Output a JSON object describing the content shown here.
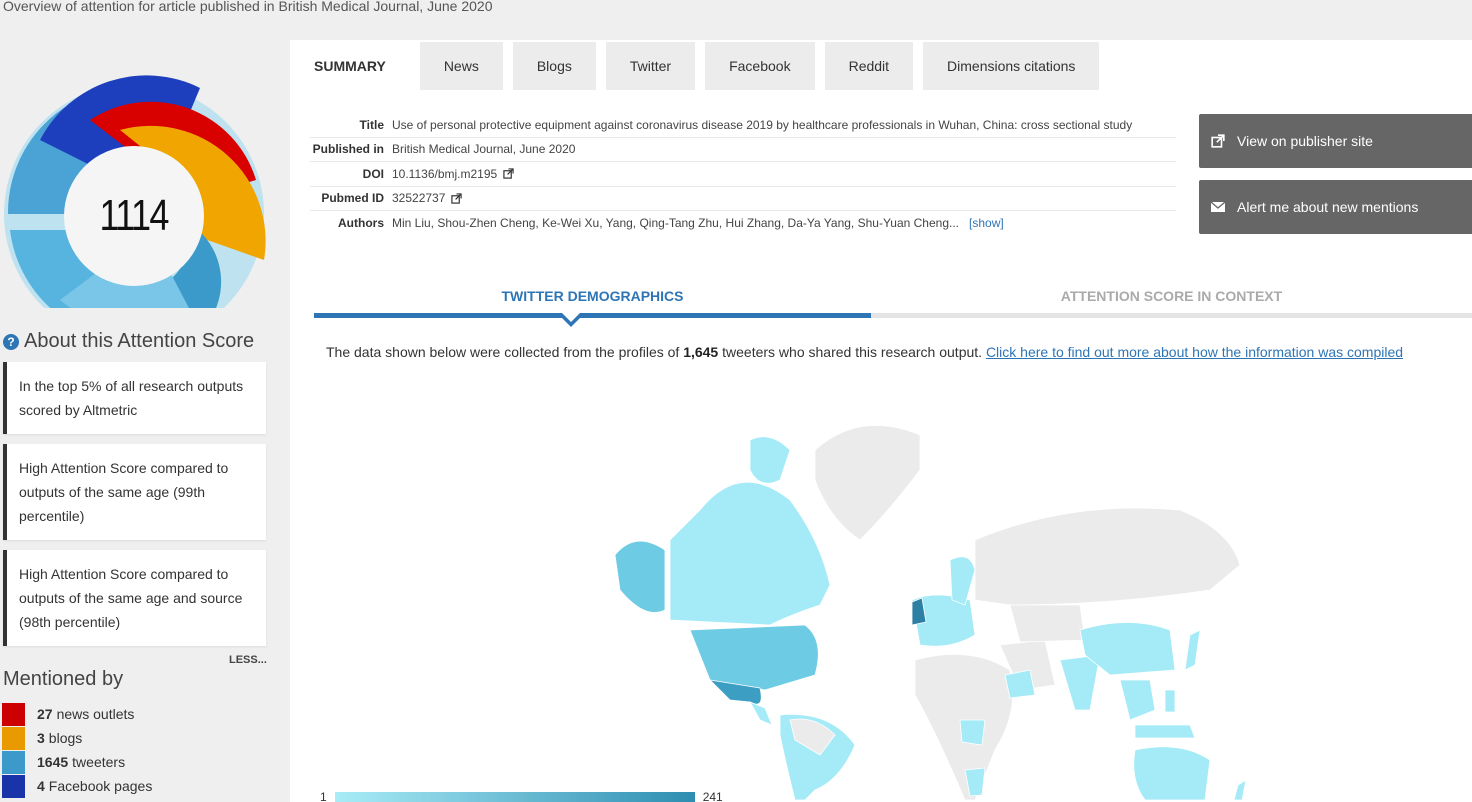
{
  "page": {
    "heading": "Overview of attention for article published in British Medical Journal, June 2020"
  },
  "score": {
    "value": "1114",
    "donut_colors": {
      "news": "#d90000",
      "blogs": "#f0a500",
      "twitter": "#4aa3d4",
      "facebook": "#1e3fbd",
      "light": "#bfe2f0"
    }
  },
  "about": {
    "title": "About this Attention Score",
    "icon": "question-icon",
    "cards": [
      "In the top 5% of all research outputs scored by Altmetric",
      "High Attention Score compared to outputs of the same age (99th percentile)",
      "High Attention Score compared to outputs of the same age and source (98th percentile)"
    ],
    "less_label": "LESS..."
  },
  "mentioned": {
    "title": "Mentioned by",
    "items": [
      {
        "count": "27",
        "label": "news outlets",
        "color": "#cc0000"
      },
      {
        "count": "3",
        "label": "blogs",
        "color": "#e89a00"
      },
      {
        "count": "1645",
        "label": "tweeters",
        "color": "#3b9ac9"
      },
      {
        "count": "4",
        "label": "Facebook pages",
        "color": "#1834a8"
      }
    ]
  },
  "tabs": [
    {
      "label": "SUMMARY",
      "active": true
    },
    {
      "label": "News"
    },
    {
      "label": "Blogs"
    },
    {
      "label": "Twitter"
    },
    {
      "label": "Facebook"
    },
    {
      "label": "Reddit"
    },
    {
      "label": "Dimensions citations"
    }
  ],
  "meta": {
    "title_label": "Title",
    "title_value": "Use of personal protective equipment against coronavirus disease 2019 by healthcare professionals in Wuhan, China: cross sectional study",
    "published_label": "Published in",
    "published_value": "British Medical Journal, June 2020",
    "doi_label": "DOI",
    "doi_value": "10.1136/bmj.m2195",
    "pubmed_label": "Pubmed ID",
    "pubmed_value": "32522737",
    "authors_label": "Authors",
    "authors_value": "Min Liu, Shou-Zhen Cheng, Ke-Wei Xu, Yang, Qing-Tang Zhu, Hui Zhang, Da-Ya Yang, Shu-Yuan Cheng...",
    "show_label": "[show]"
  },
  "actions": {
    "publisher": "View on publisher site",
    "alert": "Alert me about new mentions"
  },
  "subtabs": {
    "demographics": "TWITTER DEMOGRAPHICS",
    "context": "ATTENTION SCORE IN CONTEXT"
  },
  "collected": {
    "prefix": "The data shown below were collected from the profiles of",
    "count": "1,645",
    "suffix": "tweeters who shared this research output.",
    "link": "Click here to find out more about how the information was compiled"
  },
  "map_colors": {
    "none": "#ebebeb",
    "low": "#a4ebf7",
    "mid": "#6dcbe3",
    "high": "#3c9ec2",
    "top": "#2d7fa3"
  },
  "legend": {
    "min": "1",
    "max": "241"
  }
}
